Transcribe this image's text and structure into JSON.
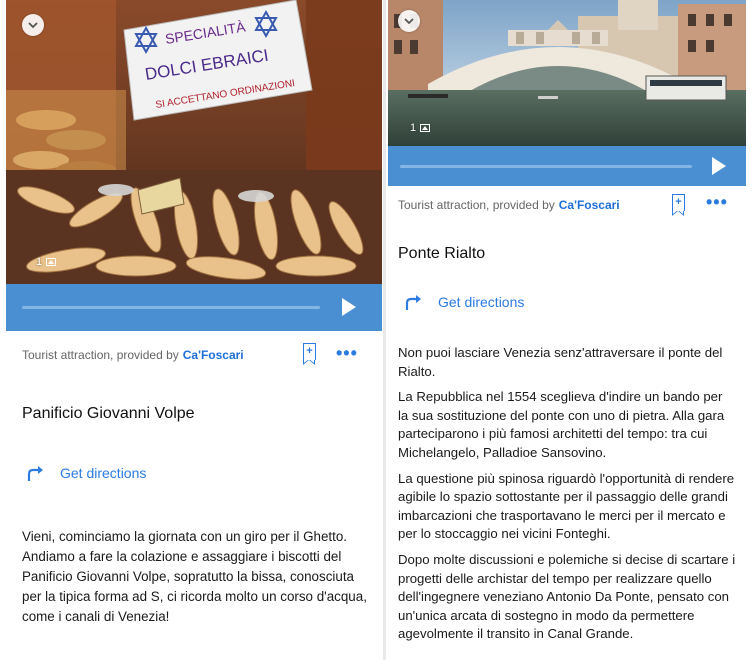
{
  "left": {
    "photo_count": "1",
    "provider_prefix": "Tourist attraction, provided by",
    "provider_name": "Ca'Foscari",
    "title": "Panificio Giovanni Volpe",
    "directions_label": "Get directions",
    "paragraphs": [
      "Vieni, cominciamo la giornata con un giro per il Ghetto. Andiamo a fare la colazione e assaggiare i biscotti del Panificio Giovanni Volpe, sopratutto la bissa, conosciuta per la tipica forma ad S, ci ricorda molto un corso d'acqua, come i canali di Venezia!"
    ],
    "sign_lines": [
      "SPECIALITÀ",
      "DOLCI EBRAICI",
      "SI ACCETTANO ORDINAZIONI"
    ]
  },
  "right": {
    "photo_count": "1",
    "provider_prefix": "Tourist attraction, provided by",
    "provider_name": "Ca'Foscari",
    "title": "Ponte Rialto",
    "directions_label": "Get directions",
    "paragraphs": [
      "Non puoi lasciare Venezia senz'attraversare il ponte del Rialto.",
      "La Repubblica nel 1554 sceglieva d'indire un bando per la sua sostituzione del ponte con uno di pietra. Alla gara parteciparono i più famosi architetti del tempo: tra cui Michelangelo, Palladioe Sansovino.",
      "La questione più spinosa riguardò l'opportunità di rendere agibile lo spazio sottostante per il passaggio delle grandi imbarcazioni che trasportavano le merci per il mercato e per lo stoccaggio nei vicini Fonteghi.",
      "Dopo molte discussioni e polemiche si decise di scartare i progetti delle archistar del tempo per realizzare quello dell'ingegnere veneziano Antonio Da Ponte, pensato con un'unica arcata di sostegno in modo da permettere agevolmente il transito in Canal Grande."
    ]
  },
  "colors": {
    "player_blue": "#4a8fd2",
    "link_blue": "#2b7be0"
  },
  "icons": {
    "collapse": "chevron-down-icon",
    "play": "play-icon",
    "bookmark": "bookmark-add-icon",
    "more": "more-icon",
    "directions": "directions-arrow-icon",
    "photo": "photo-icon"
  }
}
